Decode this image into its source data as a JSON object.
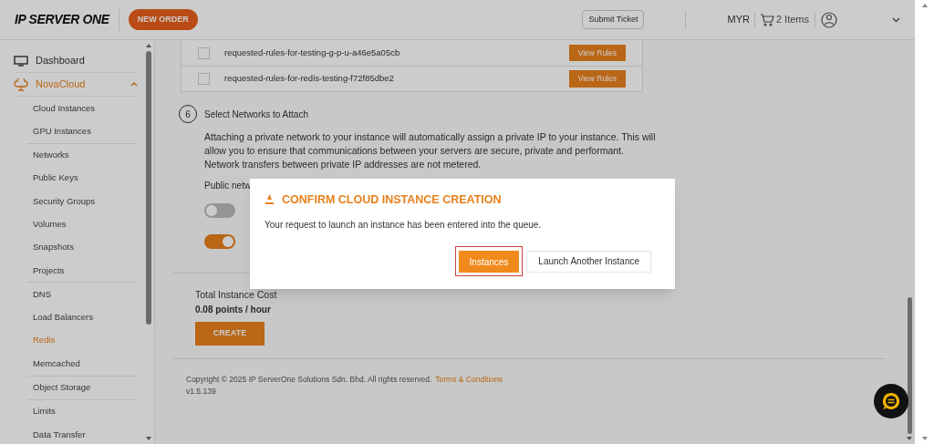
{
  "header": {
    "logo": "IP SERVER ONE",
    "new_order": "NEW ORDER",
    "submit_ticket": "Submit Ticket",
    "currency": "MYR",
    "cart": "2 Items"
  },
  "sidebar": {
    "items": [
      {
        "label": "Dashboard",
        "selected": false,
        "expanded": false
      },
      {
        "label": "NovaCloud",
        "selected": true,
        "expanded": true
      }
    ],
    "groups": [
      [
        {
          "label": "Cloud Instances",
          "selected": false
        },
        {
          "label": "GPU Instances",
          "selected": false
        }
      ],
      [
        {
          "label": "Networks",
          "selected": false
        },
        {
          "label": "Public Keys",
          "selected": false
        },
        {
          "label": "Security Groups",
          "selected": false
        },
        {
          "label": "Volumes",
          "selected": false
        },
        {
          "label": "Snapshots",
          "selected": false
        },
        {
          "label": "Projects",
          "selected": false
        }
      ],
      [
        {
          "label": "DNS",
          "selected": false
        },
        {
          "label": "Load Balancers",
          "selected": false
        },
        {
          "label": "Redis",
          "selected": true
        },
        {
          "label": "Memcached",
          "selected": false
        }
      ],
      [
        {
          "label": "Object Storage",
          "selected": false
        }
      ],
      [
        {
          "label": "Limits",
          "selected": false
        },
        {
          "label": "Data Transfer",
          "selected": false
        }
      ]
    ]
  },
  "rules": [
    {
      "name": "requested-rules-for-testing-g-p-u-a46e5a05cb",
      "checked": false,
      "button": "View Rules"
    },
    {
      "name": "requested-rules-for-redis-testing-f72f85dbe2",
      "checked": false,
      "button": "View Rules"
    }
  ],
  "step": {
    "number": "6",
    "title": "Select Networks to Attach",
    "description": "Attaching a private network to your instance will automatically assign a private IP to your instance. This will allow you to ensure that communications between your servers are secure, private and performant.",
    "note": "Network transfers between private IP addresses are not metered.",
    "public_label": "Public netw",
    "toggles": [
      {
        "on": false
      },
      {
        "on": true
      }
    ]
  },
  "cost": {
    "label": "Total Instance Cost",
    "value": "0.08 points / hour",
    "button": "CREATE"
  },
  "footer": {
    "copyright": "Copyright © 2025 IP ServerOne Solutions Sdn. Bhd. All rights reserved.",
    "terms": "Terms & Conditions",
    "version": "v1.5.139"
  },
  "dialog": {
    "title": "CONFIRM CLOUD INSTANCE CREATION",
    "message": "Your request to launch an instance has been entered into the queue.",
    "buttons": [
      {
        "label": "Instances",
        "kind": "primary"
      },
      {
        "label": "Launch Another Instance",
        "kind": "secondary"
      }
    ]
  }
}
